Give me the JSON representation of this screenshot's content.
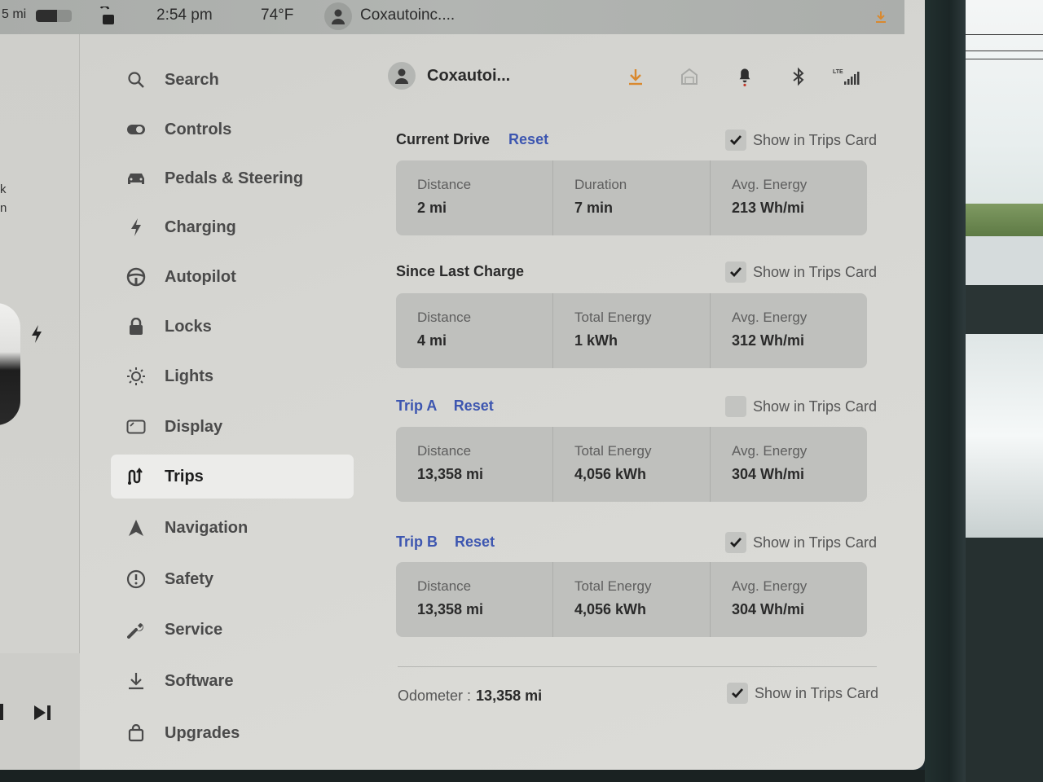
{
  "status_bar": {
    "range": "5 mi",
    "battery_level_pct": 60,
    "time": "2:54 pm",
    "temperature": "74°F",
    "user": "Coxautoinc...."
  },
  "media": {
    "partial_text_1": "k",
    "partial_text_2": "n"
  },
  "sidebar": {
    "items": [
      {
        "label": "Search",
        "icon": "search-icon"
      },
      {
        "label": "Controls",
        "icon": "toggle-icon"
      },
      {
        "label": "Pedals & Steering",
        "icon": "car-icon"
      },
      {
        "label": "Charging",
        "icon": "lightning-bolt-icon"
      },
      {
        "label": "Autopilot",
        "icon": "steering-wheel-icon"
      },
      {
        "label": "Locks",
        "icon": "lock-icon"
      },
      {
        "label": "Lights",
        "icon": "light-bulb-icon"
      },
      {
        "label": "Display",
        "icon": "display-icon"
      },
      {
        "label": "Trips",
        "icon": "trips-route-icon",
        "active": true
      },
      {
        "label": "Navigation",
        "icon": "navigation-arrow-icon"
      },
      {
        "label": "Safety",
        "icon": "alert-circle-icon"
      },
      {
        "label": "Service",
        "icon": "wrench-icon"
      },
      {
        "label": "Software",
        "icon": "download-icon"
      },
      {
        "label": "Upgrades",
        "icon": "shopping-bag-icon"
      }
    ]
  },
  "topbar": {
    "user": "Coxautoi...",
    "icons": [
      "download-icon",
      "homelink-icon",
      "bell-icon",
      "bluetooth-icon",
      "lte-signal-icon"
    ],
    "lte_label": "LTE",
    "download_color": "#d9892f",
    "bell_dot_color": "#c0392b"
  },
  "show_label": "Show in Trips Card",
  "reset_label": "Reset",
  "sections": {
    "current_drive": {
      "title": "Current Drive",
      "show_in_trips_card": true,
      "stats": [
        {
          "label": "Distance",
          "value": "2 mi"
        },
        {
          "label": "Duration",
          "value": "7 min"
        },
        {
          "label": "Avg. Energy",
          "value": "213 Wh/mi"
        }
      ]
    },
    "since_last_charge": {
      "title": "Since Last Charge",
      "show_in_trips_card": true,
      "stats": [
        {
          "label": "Distance",
          "value": "4 mi"
        },
        {
          "label": "Total Energy",
          "value": "1 kWh"
        },
        {
          "label": "Avg. Energy",
          "value": "312 Wh/mi"
        }
      ]
    },
    "trip_a": {
      "title": "Trip A",
      "show_in_trips_card": false,
      "stats": [
        {
          "label": "Distance",
          "value": "13,358 mi"
        },
        {
          "label": "Total Energy",
          "value": "4,056 kWh"
        },
        {
          "label": "Avg. Energy",
          "value": "304 Wh/mi"
        }
      ]
    },
    "trip_b": {
      "title": "Trip B",
      "show_in_trips_card": true,
      "stats": [
        {
          "label": "Distance",
          "value": "13,358 mi"
        },
        {
          "label": "Total Energy",
          "value": "4,056 kWh"
        },
        {
          "label": "Avg. Energy",
          "value": "304 Wh/mi"
        }
      ]
    }
  },
  "odometer": {
    "label": "Odometer  :",
    "value": "13,358 mi",
    "show_in_trips_card": true
  },
  "colors": {
    "link_blue": "#3d56b0",
    "active_nav_bg": "#ececea"
  }
}
